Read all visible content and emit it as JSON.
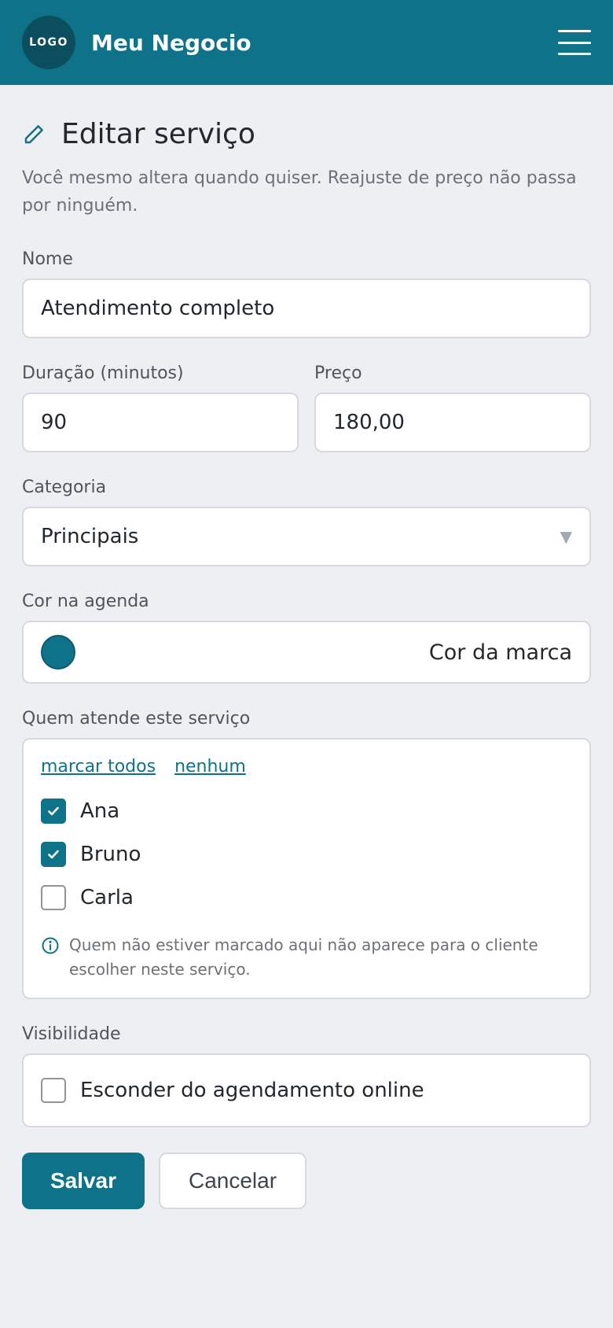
{
  "header": {
    "logo_text": "LOGO",
    "business_name": "Meu Negocio",
    "menu_icon": "hamburger-menu-icon"
  },
  "page": {
    "title": "Editar serviço",
    "title_icon": "pencil-icon",
    "subtitle": "Você mesmo altera quando quiser. Reajuste de preço não passa por ninguém."
  },
  "form": {
    "name": {
      "label": "Nome",
      "value": "Atendimento completo"
    },
    "duration": {
      "label": "Duração (minutos)",
      "value": "90"
    },
    "price": {
      "label": "Preço",
      "value": "180,00"
    },
    "category": {
      "label": "Categoria",
      "value": "Principais"
    },
    "color": {
      "label": "Cor na agenda",
      "value": "Cor da marca",
      "swatch": "#0e7388"
    },
    "staff": {
      "label": "Quem atende este serviço",
      "select_all": "marcar todos",
      "select_none": "nenhum",
      "members": [
        {
          "name": "Ana",
          "checked": true
        },
        {
          "name": "Bruno",
          "checked": true
        },
        {
          "name": "Carla",
          "checked": false
        }
      ],
      "note": "Quem não estiver marcado aqui não aparece para o cliente escolher neste serviço."
    },
    "visibility": {
      "label": "Visibilidade",
      "option": "Esconder do agendamento online",
      "checked": false
    }
  },
  "actions": {
    "save": "Salvar",
    "cancel": "Cancelar"
  },
  "colors": {
    "brand": "#0e7388",
    "background": "#eeeff2"
  }
}
